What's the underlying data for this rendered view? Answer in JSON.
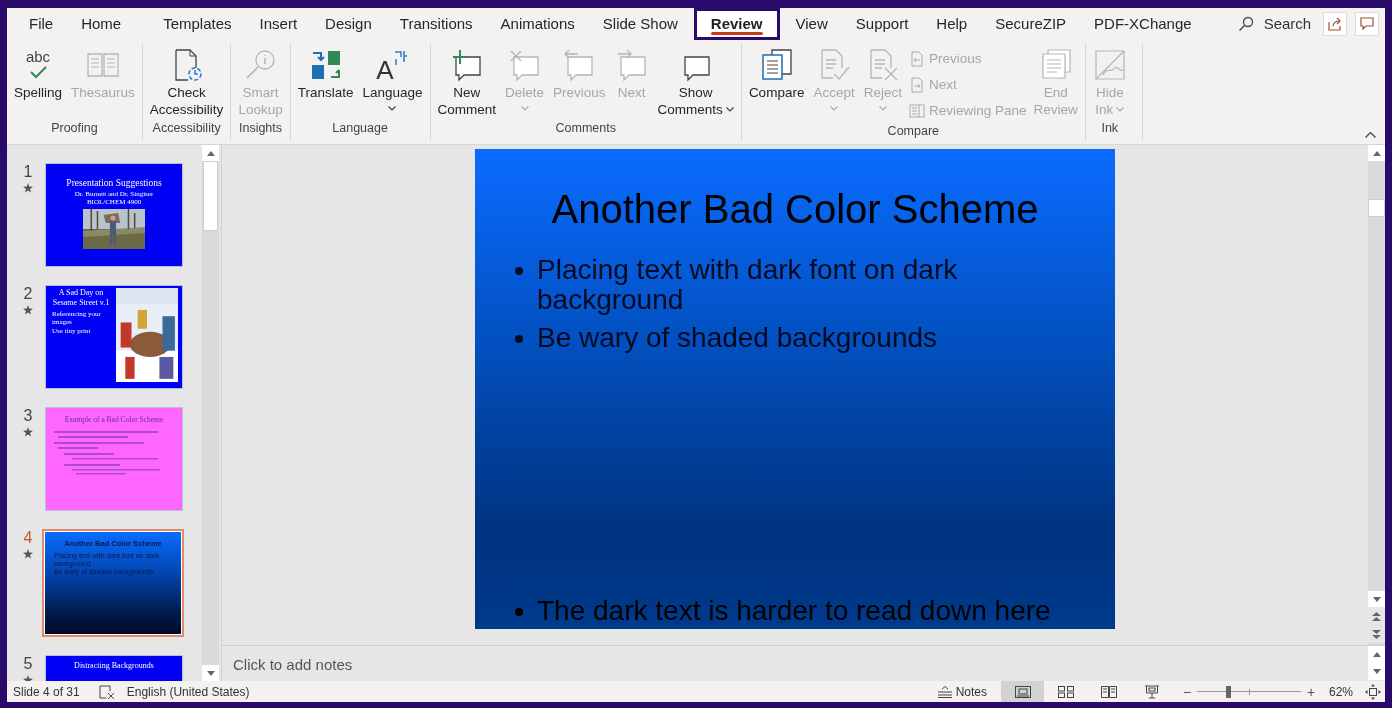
{
  "tabs": [
    {
      "label": "File",
      "selected": false
    },
    {
      "label": "Home",
      "selected": false
    },
    {
      "label": "Templates",
      "selected": false
    },
    {
      "label": "Insert",
      "selected": false
    },
    {
      "label": "Design",
      "selected": false
    },
    {
      "label": "Transitions",
      "selected": false
    },
    {
      "label": "Animations",
      "selected": false
    },
    {
      "label": "Slide Show",
      "selected": false
    },
    {
      "label": "Review",
      "selected": true
    },
    {
      "label": "View",
      "selected": false
    },
    {
      "label": "Support",
      "selected": false
    },
    {
      "label": "Help",
      "selected": false
    },
    {
      "label": "SecureZIP",
      "selected": false
    },
    {
      "label": "PDF-XChange",
      "selected": false
    }
  ],
  "search": {
    "placeholder": "Search"
  },
  "ribbon": [
    {
      "label": "Proofing",
      "buttons": [
        {
          "kind": "large",
          "lines": [
            "Spelling"
          ],
          "icon_text": "abc",
          "disabled": false,
          "dropdown": false
        },
        {
          "kind": "large",
          "lines": [
            "Thesaurus"
          ],
          "disabled": true,
          "dropdown": false
        }
      ]
    },
    {
      "label": "Accessibility",
      "buttons": [
        {
          "kind": "large",
          "lines": [
            "Check",
            "Accessibility"
          ],
          "disabled": false,
          "dropdown": false
        }
      ]
    },
    {
      "label": "Insights",
      "buttons": [
        {
          "kind": "large",
          "lines": [
            "Smart",
            "Lookup"
          ],
          "disabled": true,
          "dropdown": false
        }
      ]
    },
    {
      "label": "Language",
      "buttons": [
        {
          "kind": "large",
          "lines": [
            "Translate"
          ],
          "disabled": false,
          "dropdown": false
        },
        {
          "kind": "large",
          "lines": [
            "Language"
          ],
          "icon_text": "A",
          "disabled": false,
          "dropdown": true
        }
      ]
    },
    {
      "label": "Comments",
      "buttons": [
        {
          "kind": "large",
          "lines": [
            "New",
            "Comment"
          ],
          "disabled": false,
          "dropdown": false
        },
        {
          "kind": "large",
          "lines": [
            "Delete"
          ],
          "disabled": true,
          "dropdown": true
        },
        {
          "kind": "large",
          "lines": [
            "Previous"
          ],
          "disabled": true,
          "dropdown": false
        },
        {
          "kind": "large",
          "lines": [
            "Next"
          ],
          "disabled": true,
          "dropdown": false
        },
        {
          "kind": "large",
          "lines": [
            "Show",
            "Comments"
          ],
          "disabled": false,
          "dropdown": true
        }
      ]
    },
    {
      "label": "Compare",
      "buttons": [
        {
          "kind": "large",
          "lines": [
            "Compare"
          ],
          "disabled": false,
          "dropdown": false
        },
        {
          "kind": "large",
          "lines": [
            "Accept"
          ],
          "disabled": true,
          "dropdown": true
        },
        {
          "kind": "large",
          "lines": [
            "Reject"
          ],
          "disabled": true,
          "dropdown": true
        },
        {
          "kind": "stack",
          "items": [
            {
              "label": "Previous",
              "disabled": true
            },
            {
              "label": "Next",
              "disabled": true
            },
            {
              "label": "Reviewing Pane",
              "disabled": true
            }
          ]
        },
        {
          "kind": "large",
          "lines": [
            "End",
            "Review"
          ],
          "disabled": true,
          "dropdown": false
        }
      ]
    },
    {
      "label": "Ink",
      "buttons": [
        {
          "kind": "large",
          "lines": [
            "Hide",
            "Ink"
          ],
          "disabled": true,
          "dropdown": true
        }
      ]
    }
  ],
  "slides": [
    {
      "number": "1",
      "selected": false,
      "kind": "title",
      "title": "Presentation Suggestions",
      "subtitle": [
        "Dr. Burnett and Dr. Singiser",
        "BIOL/CHEM 4900"
      ]
    },
    {
      "number": "2",
      "selected": false,
      "kind": "picture_right",
      "title": "A Sad Day on Sesame Street v.1",
      "bullets": [
        "Referencing your images",
        "Use tiny print"
      ]
    },
    {
      "number": "3",
      "selected": false,
      "kind": "outline",
      "title": "Example of a Bad Color Scheme"
    },
    {
      "number": "4",
      "selected": true,
      "kind": "gradient",
      "title": "Another Bad Color Scheme",
      "bullets": [
        "Placing text with dark font on dark background",
        "Be wary of shaded backgrounds"
      ]
    },
    {
      "number": "5",
      "selected": false,
      "kind": "title_only",
      "title": "Distracting Backgrounds"
    }
  ],
  "slide": {
    "title": "Another Bad Color Scheme",
    "bullets": [
      "Placing text with dark font on dark background",
      "Be wary of shaded backgrounds"
    ],
    "bottom_bullet": "The dark text is harder to read down here"
  },
  "notes": {
    "placeholder": "Click to add notes"
  },
  "status_bar": {
    "slide_info": "Slide 4 of 31",
    "language": "English (United States)",
    "notes": "Notes",
    "views": [
      {
        "selected": true
      },
      {
        "selected": false
      },
      {
        "selected": false
      },
      {
        "selected": false
      }
    ],
    "zoom": {
      "level": 0.29,
      "reading": "62%",
      "zoom_out": "−",
      "zoom_in": "+"
    }
  }
}
